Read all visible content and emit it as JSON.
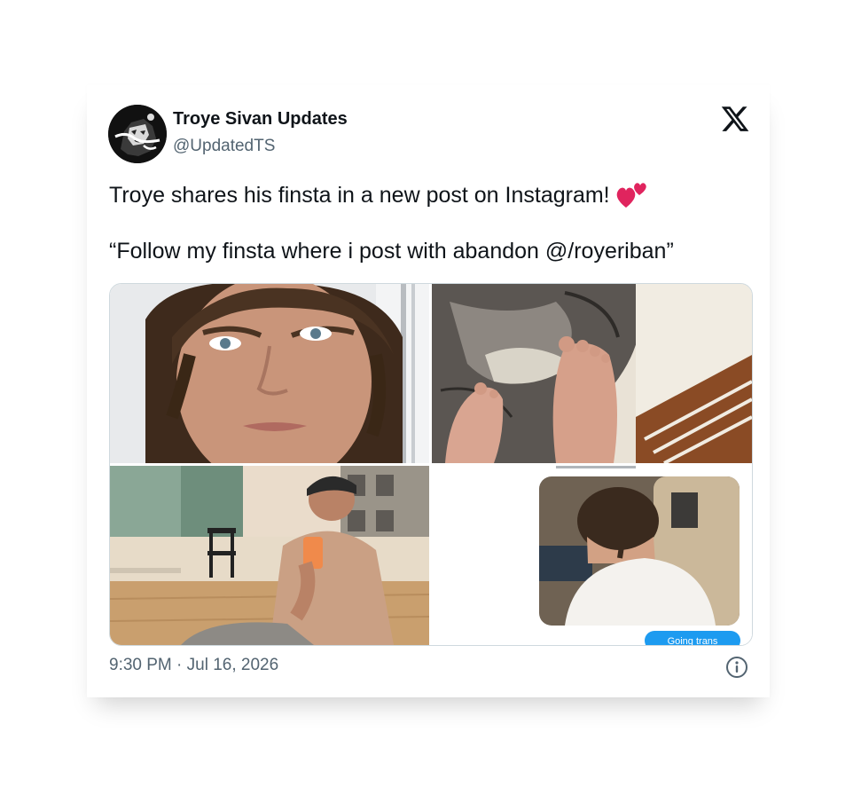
{
  "tweet": {
    "author_name": "Troye Sivan Updates",
    "author_handle": "@UpdatedTS",
    "text_line1": "Troye shares his finsta in a new post on Instagram!",
    "text_line2": "“Follow my finsta where i post with abandon @/royeriban”",
    "emoji": "two-hearts",
    "timestamp": "9:30 PM · Jul 16, 2026"
  },
  "media": {
    "count": 4,
    "images": [
      {
        "description_icon": "selfie-photo"
      },
      {
        "description_icon": "feet-photo"
      },
      {
        "description_icon": "mirror-selfie-photo"
      },
      {
        "description_icon": "chat-screenshot-photo"
      }
    ],
    "chat_bubble_text": "Going trans"
  },
  "colors": {
    "text_primary": "#0f1419",
    "text_secondary": "#536471",
    "border": "#cfd9de",
    "heart": "#e0245e",
    "chat_bubble": "#1d9bf0"
  }
}
